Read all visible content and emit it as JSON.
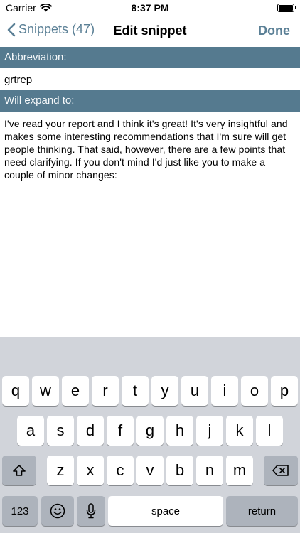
{
  "status_bar": {
    "carrier": "Carrier",
    "time": "8:37 PM",
    "wifi_icon": "wifi-icon",
    "battery_icon": "battery-icon"
  },
  "nav": {
    "back_label": "Snippets (47)",
    "title": "Edit snippet",
    "done_label": "Done"
  },
  "form": {
    "abbreviation_label": "Abbreviation:",
    "abbreviation_value": "grtrep",
    "expand_label": "Will expand to:",
    "expansion_text": "I've read your report and I think it's great! It's very insightful and makes some interesting recommendations that I'm sure will get people thinking. That said, however, there are a few points that need clarifying. If you don't mind I'd just like you to make a couple of minor changes:"
  },
  "colors": {
    "accent": "#5b8096",
    "section_header": "#557a8f",
    "keyboard_bg": "#d1d4da"
  },
  "keyboard": {
    "row1": [
      "q",
      "w",
      "e",
      "r",
      "t",
      "y",
      "u",
      "i",
      "o",
      "p"
    ],
    "row2": [
      "a",
      "s",
      "d",
      "f",
      "g",
      "h",
      "j",
      "k",
      "l"
    ],
    "row3": [
      "z",
      "x",
      "c",
      "v",
      "b",
      "n",
      "m"
    ],
    "numbers_key": "123",
    "space_key": "space",
    "return_key": "return",
    "icons": {
      "shift": "shift-icon",
      "delete": "delete-icon",
      "emoji": "emoji-icon",
      "mic": "microphone-icon"
    }
  }
}
